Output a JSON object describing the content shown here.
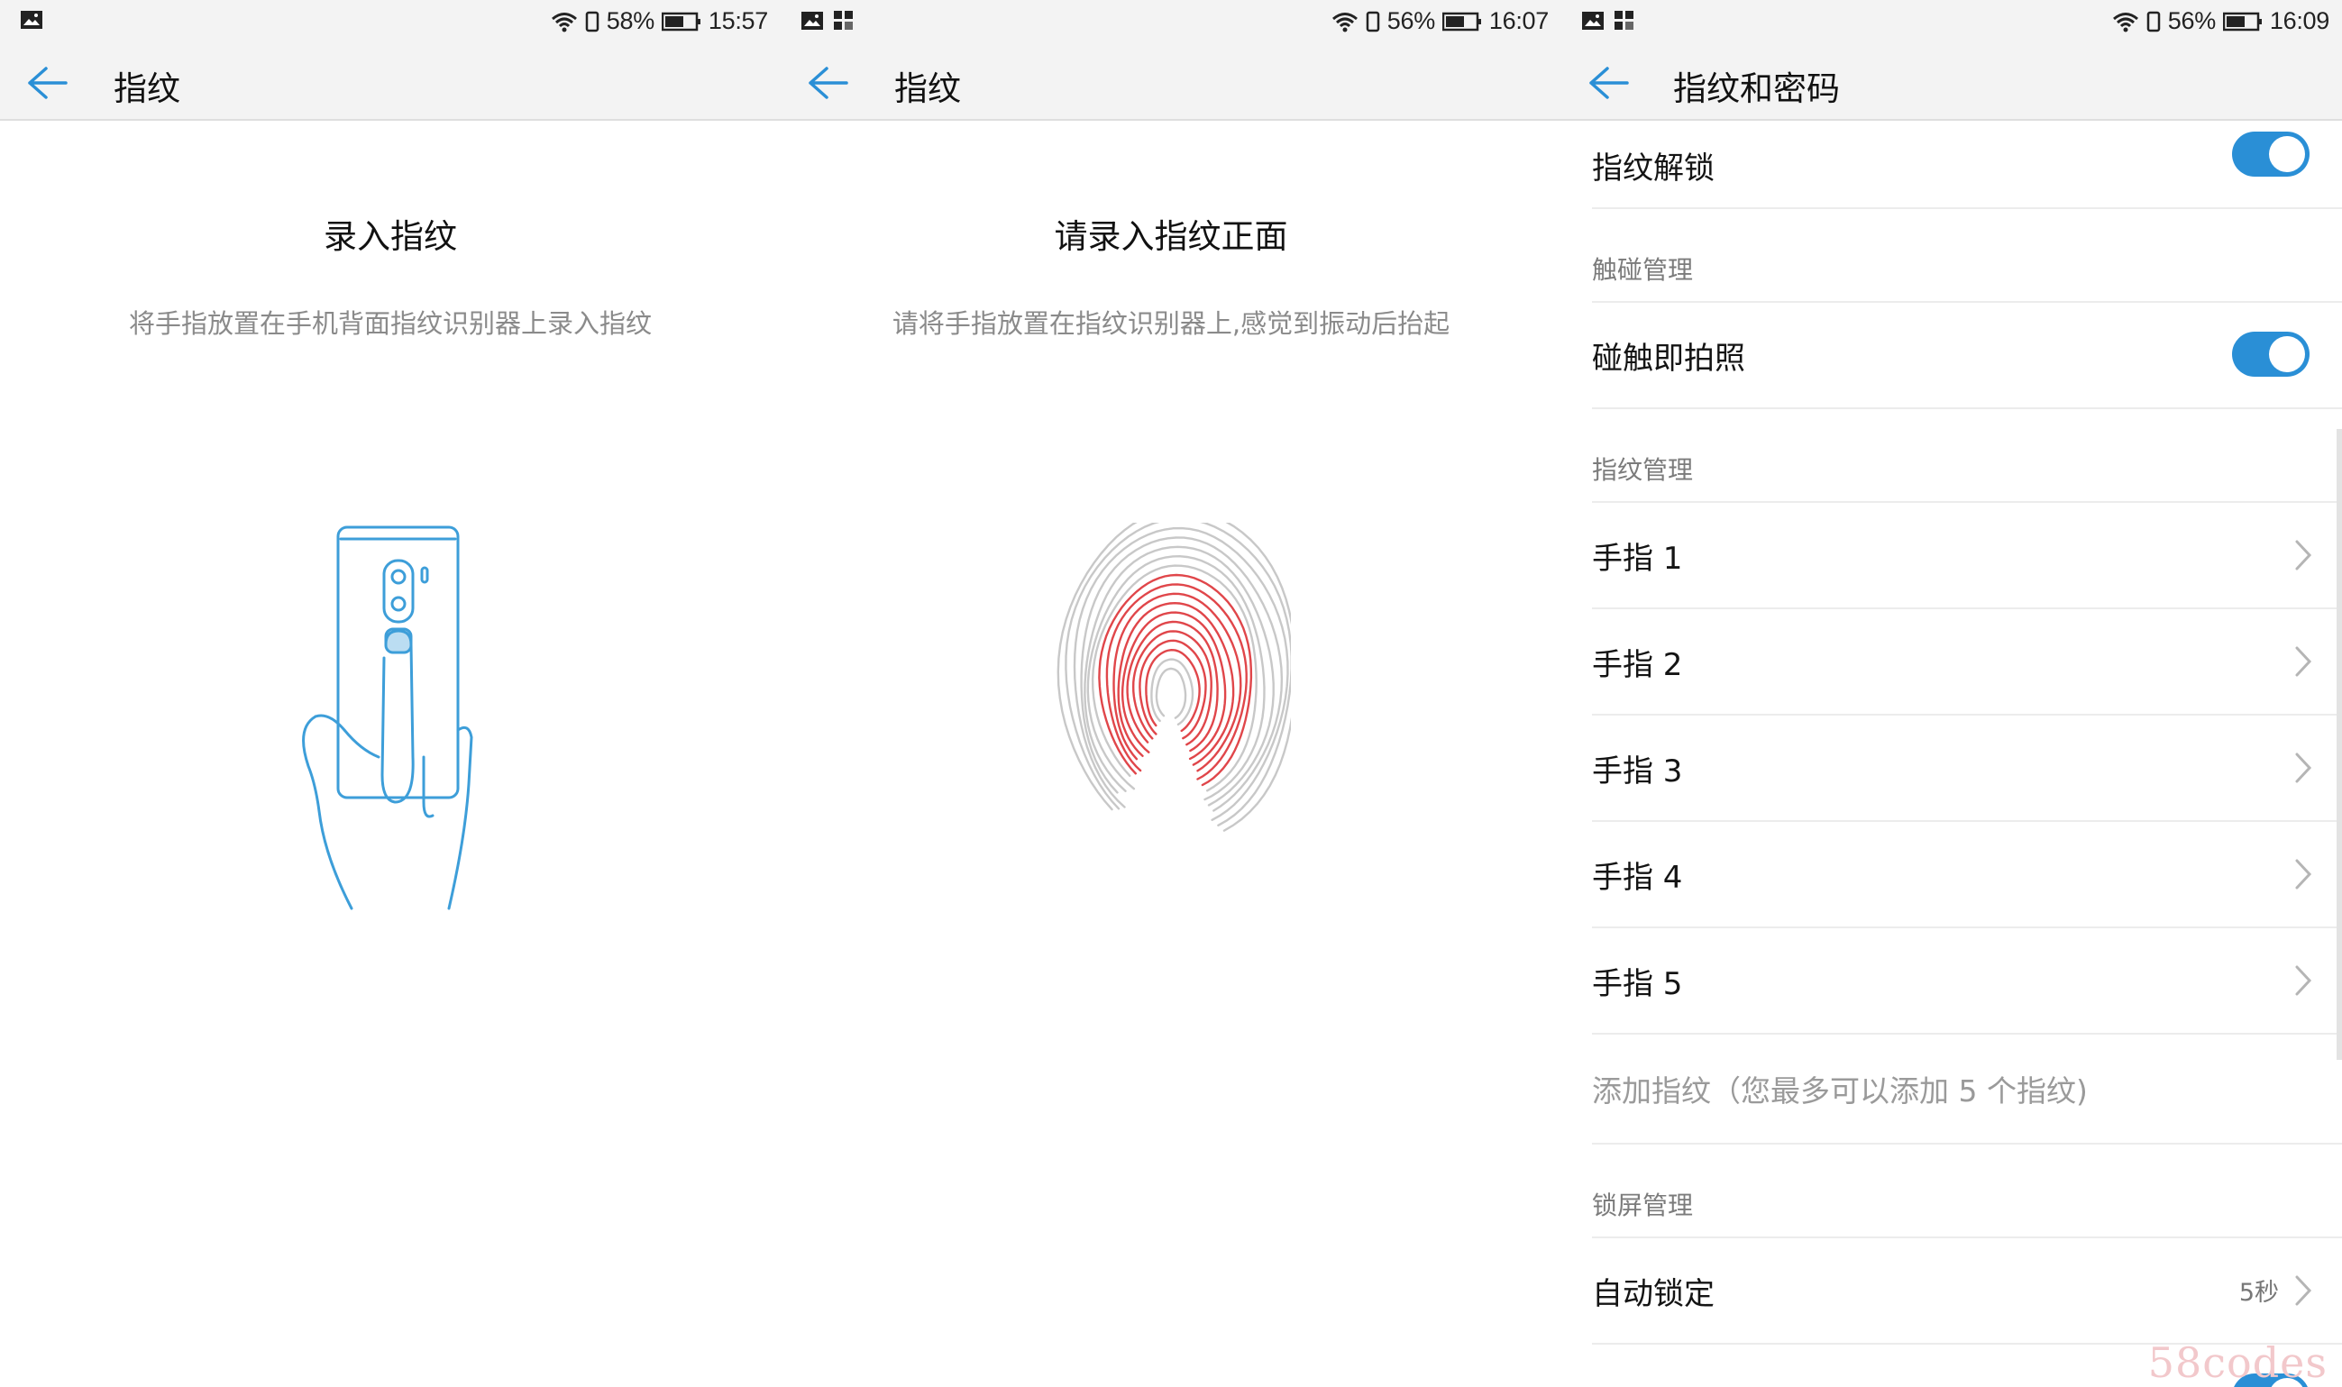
{
  "panels": [
    {
      "status": {
        "battery": "58%",
        "time": "15:57"
      },
      "title": "指纹",
      "heading": "录入指纹",
      "description": "将手指放置在手机背面指纹识别器上录入指纹"
    },
    {
      "status": {
        "battery": "56%",
        "time": "16:07"
      },
      "title": "指纹",
      "heading": "请录入指纹正面",
      "description": "请将手指放置在指纹识别器上,感觉到振动后抬起"
    },
    {
      "status": {
        "battery": "56%",
        "time": "16:09"
      },
      "title": "指纹和密码",
      "fingerprint_unlock": {
        "label": "指纹解锁",
        "enabled": true
      },
      "touch_section": "触碰管理",
      "touch_photo": {
        "label": "碰触即拍照",
        "enabled": true
      },
      "fp_section": "指纹管理",
      "fingers": [
        "手指 1",
        "手指 2",
        "手指 3",
        "手指 4",
        "手指 5"
      ],
      "add_fingerprint": "添加指纹（您最多可以添加 5 个指纹)",
      "lock_section": "锁屏管理",
      "auto_lock": {
        "label": "自动锁定",
        "value": "5秒"
      }
    }
  ],
  "colors": {
    "accent": "#2a8fd6",
    "fingerprint_red": "#e0464a",
    "fingerprint_gray": "#c8c8c8",
    "phone_blue": "#3d9ed9"
  },
  "icons": [
    "image-icon",
    "app-grid-icon",
    "wifi-icon",
    "vibrate-icon",
    "battery-icon",
    "back-arrow-icon",
    "chevron-right-icon",
    "phone-hand-illustration",
    "fingerprint-illustration"
  ],
  "watermark": "58codes"
}
